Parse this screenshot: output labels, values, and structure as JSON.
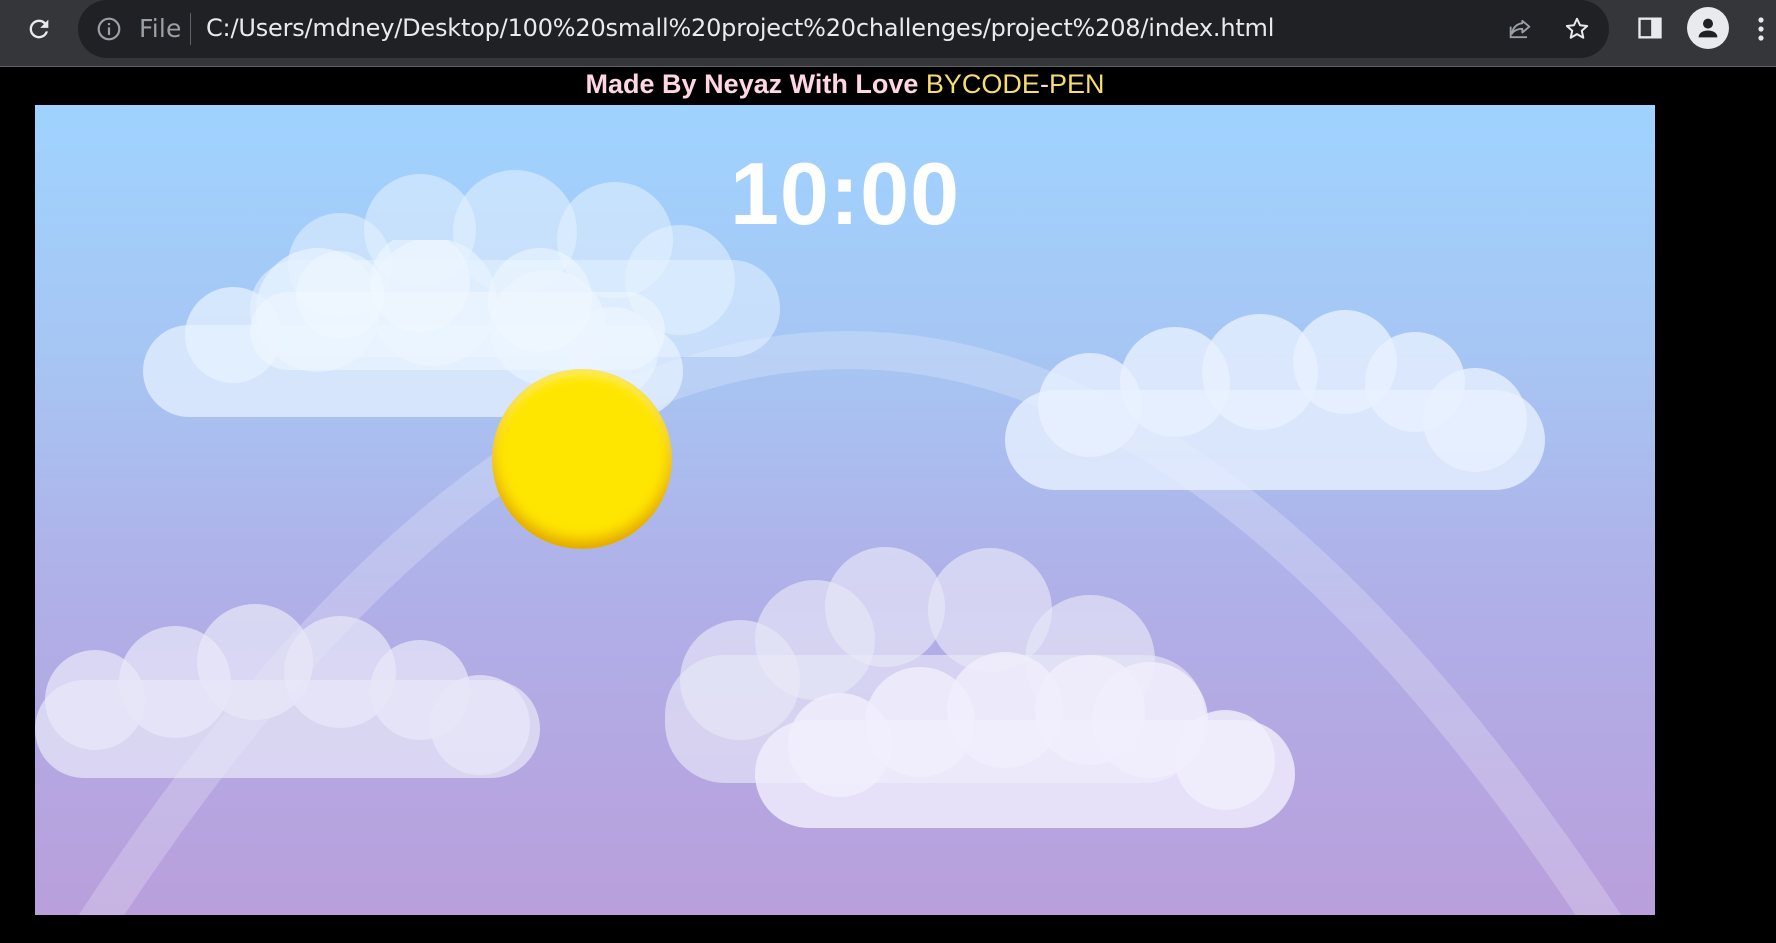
{
  "browser": {
    "address_bar": {
      "scheme_label": "File",
      "url": "C:/Users/mdney/Desktop/100%20small%20project%20challenges/project%208/index.html"
    },
    "icons": [
      "reload-icon",
      "info-icon",
      "share-icon",
      "bookmark-star-icon",
      "side-panel-icon",
      "profile-icon",
      "menu-icon"
    ]
  },
  "page": {
    "credit": {
      "made_by": "Made By Neyaz With Love",
      "by_label": "BY",
      "code": "CODE",
      "dash": "-",
      "pen": "PEN"
    },
    "clock_time": "10:00"
  },
  "colors": {
    "credit_made_by": "#ffd6e4",
    "credit_by_code_pen": "#f7dc6f",
    "credit_dash": "#ffd6e4",
    "clock": "#ffffff",
    "sun": "#ffe600",
    "sky_top": "#a0d3ff",
    "sky_bottom": "#b99fdc"
  }
}
